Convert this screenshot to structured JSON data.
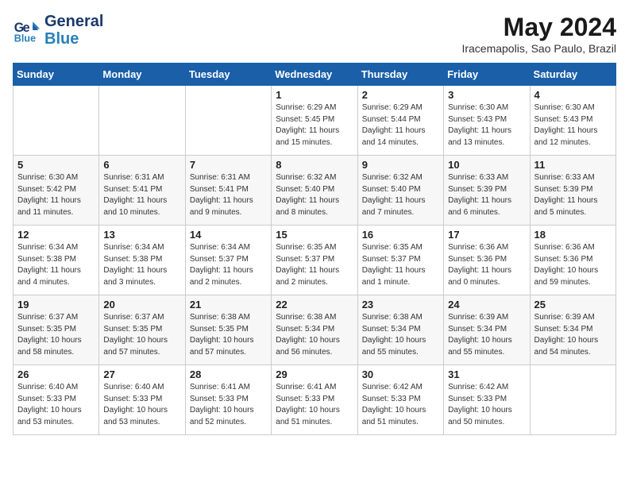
{
  "header": {
    "logo_line1": "General",
    "logo_line2": "Blue",
    "month": "May 2024",
    "location": "Iracemapolis, Sao Paulo, Brazil"
  },
  "weekdays": [
    "Sunday",
    "Monday",
    "Tuesday",
    "Wednesday",
    "Thursday",
    "Friday",
    "Saturday"
  ],
  "weeks": [
    [
      {
        "day": "",
        "info": ""
      },
      {
        "day": "",
        "info": ""
      },
      {
        "day": "",
        "info": ""
      },
      {
        "day": "1",
        "info": "Sunrise: 6:29 AM\nSunset: 5:45 PM\nDaylight: 11 hours\nand 15 minutes."
      },
      {
        "day": "2",
        "info": "Sunrise: 6:29 AM\nSunset: 5:44 PM\nDaylight: 11 hours\nand 14 minutes."
      },
      {
        "day": "3",
        "info": "Sunrise: 6:30 AM\nSunset: 5:43 PM\nDaylight: 11 hours\nand 13 minutes."
      },
      {
        "day": "4",
        "info": "Sunrise: 6:30 AM\nSunset: 5:43 PM\nDaylight: 11 hours\nand 12 minutes."
      }
    ],
    [
      {
        "day": "5",
        "info": "Sunrise: 6:30 AM\nSunset: 5:42 PM\nDaylight: 11 hours\nand 11 minutes."
      },
      {
        "day": "6",
        "info": "Sunrise: 6:31 AM\nSunset: 5:41 PM\nDaylight: 11 hours\nand 10 minutes."
      },
      {
        "day": "7",
        "info": "Sunrise: 6:31 AM\nSunset: 5:41 PM\nDaylight: 11 hours\nand 9 minutes."
      },
      {
        "day": "8",
        "info": "Sunrise: 6:32 AM\nSunset: 5:40 PM\nDaylight: 11 hours\nand 8 minutes."
      },
      {
        "day": "9",
        "info": "Sunrise: 6:32 AM\nSunset: 5:40 PM\nDaylight: 11 hours\nand 7 minutes."
      },
      {
        "day": "10",
        "info": "Sunrise: 6:33 AM\nSunset: 5:39 PM\nDaylight: 11 hours\nand 6 minutes."
      },
      {
        "day": "11",
        "info": "Sunrise: 6:33 AM\nSunset: 5:39 PM\nDaylight: 11 hours\nand 5 minutes."
      }
    ],
    [
      {
        "day": "12",
        "info": "Sunrise: 6:34 AM\nSunset: 5:38 PM\nDaylight: 11 hours\nand 4 minutes."
      },
      {
        "day": "13",
        "info": "Sunrise: 6:34 AM\nSunset: 5:38 PM\nDaylight: 11 hours\nand 3 minutes."
      },
      {
        "day": "14",
        "info": "Sunrise: 6:34 AM\nSunset: 5:37 PM\nDaylight: 11 hours\nand 2 minutes."
      },
      {
        "day": "15",
        "info": "Sunrise: 6:35 AM\nSunset: 5:37 PM\nDaylight: 11 hours\nand 2 minutes."
      },
      {
        "day": "16",
        "info": "Sunrise: 6:35 AM\nSunset: 5:37 PM\nDaylight: 11 hours\nand 1 minute."
      },
      {
        "day": "17",
        "info": "Sunrise: 6:36 AM\nSunset: 5:36 PM\nDaylight: 11 hours\nand 0 minutes."
      },
      {
        "day": "18",
        "info": "Sunrise: 6:36 AM\nSunset: 5:36 PM\nDaylight: 10 hours\nand 59 minutes."
      }
    ],
    [
      {
        "day": "19",
        "info": "Sunrise: 6:37 AM\nSunset: 5:35 PM\nDaylight: 10 hours\nand 58 minutes."
      },
      {
        "day": "20",
        "info": "Sunrise: 6:37 AM\nSunset: 5:35 PM\nDaylight: 10 hours\nand 57 minutes."
      },
      {
        "day": "21",
        "info": "Sunrise: 6:38 AM\nSunset: 5:35 PM\nDaylight: 10 hours\nand 57 minutes."
      },
      {
        "day": "22",
        "info": "Sunrise: 6:38 AM\nSunset: 5:34 PM\nDaylight: 10 hours\nand 56 minutes."
      },
      {
        "day": "23",
        "info": "Sunrise: 6:38 AM\nSunset: 5:34 PM\nDaylight: 10 hours\nand 55 minutes."
      },
      {
        "day": "24",
        "info": "Sunrise: 6:39 AM\nSunset: 5:34 PM\nDaylight: 10 hours\nand 55 minutes."
      },
      {
        "day": "25",
        "info": "Sunrise: 6:39 AM\nSunset: 5:34 PM\nDaylight: 10 hours\nand 54 minutes."
      }
    ],
    [
      {
        "day": "26",
        "info": "Sunrise: 6:40 AM\nSunset: 5:33 PM\nDaylight: 10 hours\nand 53 minutes."
      },
      {
        "day": "27",
        "info": "Sunrise: 6:40 AM\nSunset: 5:33 PM\nDaylight: 10 hours\nand 53 minutes."
      },
      {
        "day": "28",
        "info": "Sunrise: 6:41 AM\nSunset: 5:33 PM\nDaylight: 10 hours\nand 52 minutes."
      },
      {
        "day": "29",
        "info": "Sunrise: 6:41 AM\nSunset: 5:33 PM\nDaylight: 10 hours\nand 51 minutes."
      },
      {
        "day": "30",
        "info": "Sunrise: 6:42 AM\nSunset: 5:33 PM\nDaylight: 10 hours\nand 51 minutes."
      },
      {
        "day": "31",
        "info": "Sunrise: 6:42 AM\nSunset: 5:33 PM\nDaylight: 10 hours\nand 50 minutes."
      },
      {
        "day": "",
        "info": ""
      }
    ]
  ]
}
